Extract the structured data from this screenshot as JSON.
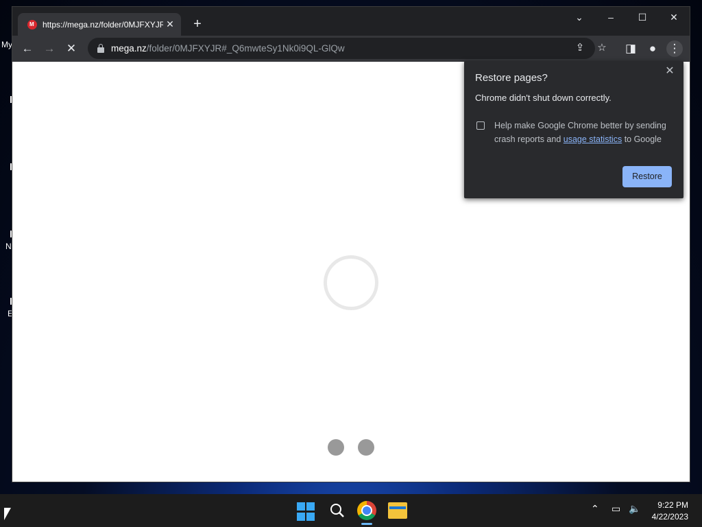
{
  "desktop": {
    "label_my": "My",
    "label_n": "N",
    "label_e": "E"
  },
  "tab": {
    "title": "https://mega.nz/folder/0MJFXYJR#",
    "close_glyph": "✕"
  },
  "window_controls": {
    "dropdown": "⌄",
    "minimize": "–",
    "maximize": "☐",
    "close": "✕"
  },
  "toolbar": {
    "url_host": "mega.nz",
    "url_path": "/folder/0MJFXYJR#_Q6mwteSy1Nk0i9QL-GlQw",
    "icons": [
      "back-arrow-icon",
      "forward-arrow-icon",
      "stop-loading-icon",
      "share-icon",
      "bookmark-star-icon",
      "side-panel-icon",
      "profile-icon",
      "menu-kebab-icon"
    ]
  },
  "popup": {
    "title": "Restore pages?",
    "message": "Chrome didn't shut down correctly.",
    "help_prefix": "Help make Google Chrome better by sending crash reports and ",
    "help_link": "usage statistics",
    "help_suffix": " to Google",
    "restore_label": "Restore",
    "checkbox_checked": false,
    "accent": "#8ab4f8"
  },
  "taskbar": {
    "time": "9:22 PM",
    "date": "4/22/2023",
    "apps": [
      "windows-start-icon",
      "search-icon",
      "chrome-icon",
      "file-explorer-icon"
    ]
  }
}
